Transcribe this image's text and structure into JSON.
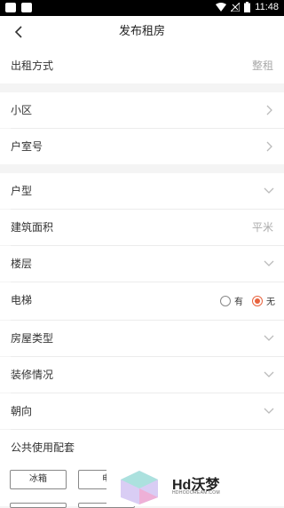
{
  "status_bar": {
    "time": "11:48"
  },
  "header": {
    "title": "发布租房"
  },
  "form": {
    "rental_mode": {
      "label": "出租方式",
      "value": "整租"
    },
    "community": {
      "label": "小区"
    },
    "room_number": {
      "label": "户室号"
    },
    "layout": {
      "label": "户型"
    },
    "area": {
      "label": "建筑面积",
      "unit": "平米"
    },
    "floor": {
      "label": "楼层"
    },
    "elevator": {
      "label": "电梯",
      "option_yes": "有",
      "option_no": "无",
      "selected": "无"
    },
    "house_type": {
      "label": "房屋类型"
    },
    "decoration": {
      "label": "装修情况"
    },
    "orientation": {
      "label": "朝向"
    },
    "facilities": {
      "label": "公共使用配套",
      "tags": [
        "冰箱",
        "电"
      ]
    }
  },
  "watermark": {
    "text": "Hd沃梦",
    "sub": "HDHODOREAM.COM"
  },
  "colors": {
    "accent": "#e8633e",
    "background": "#f4f4f4"
  }
}
